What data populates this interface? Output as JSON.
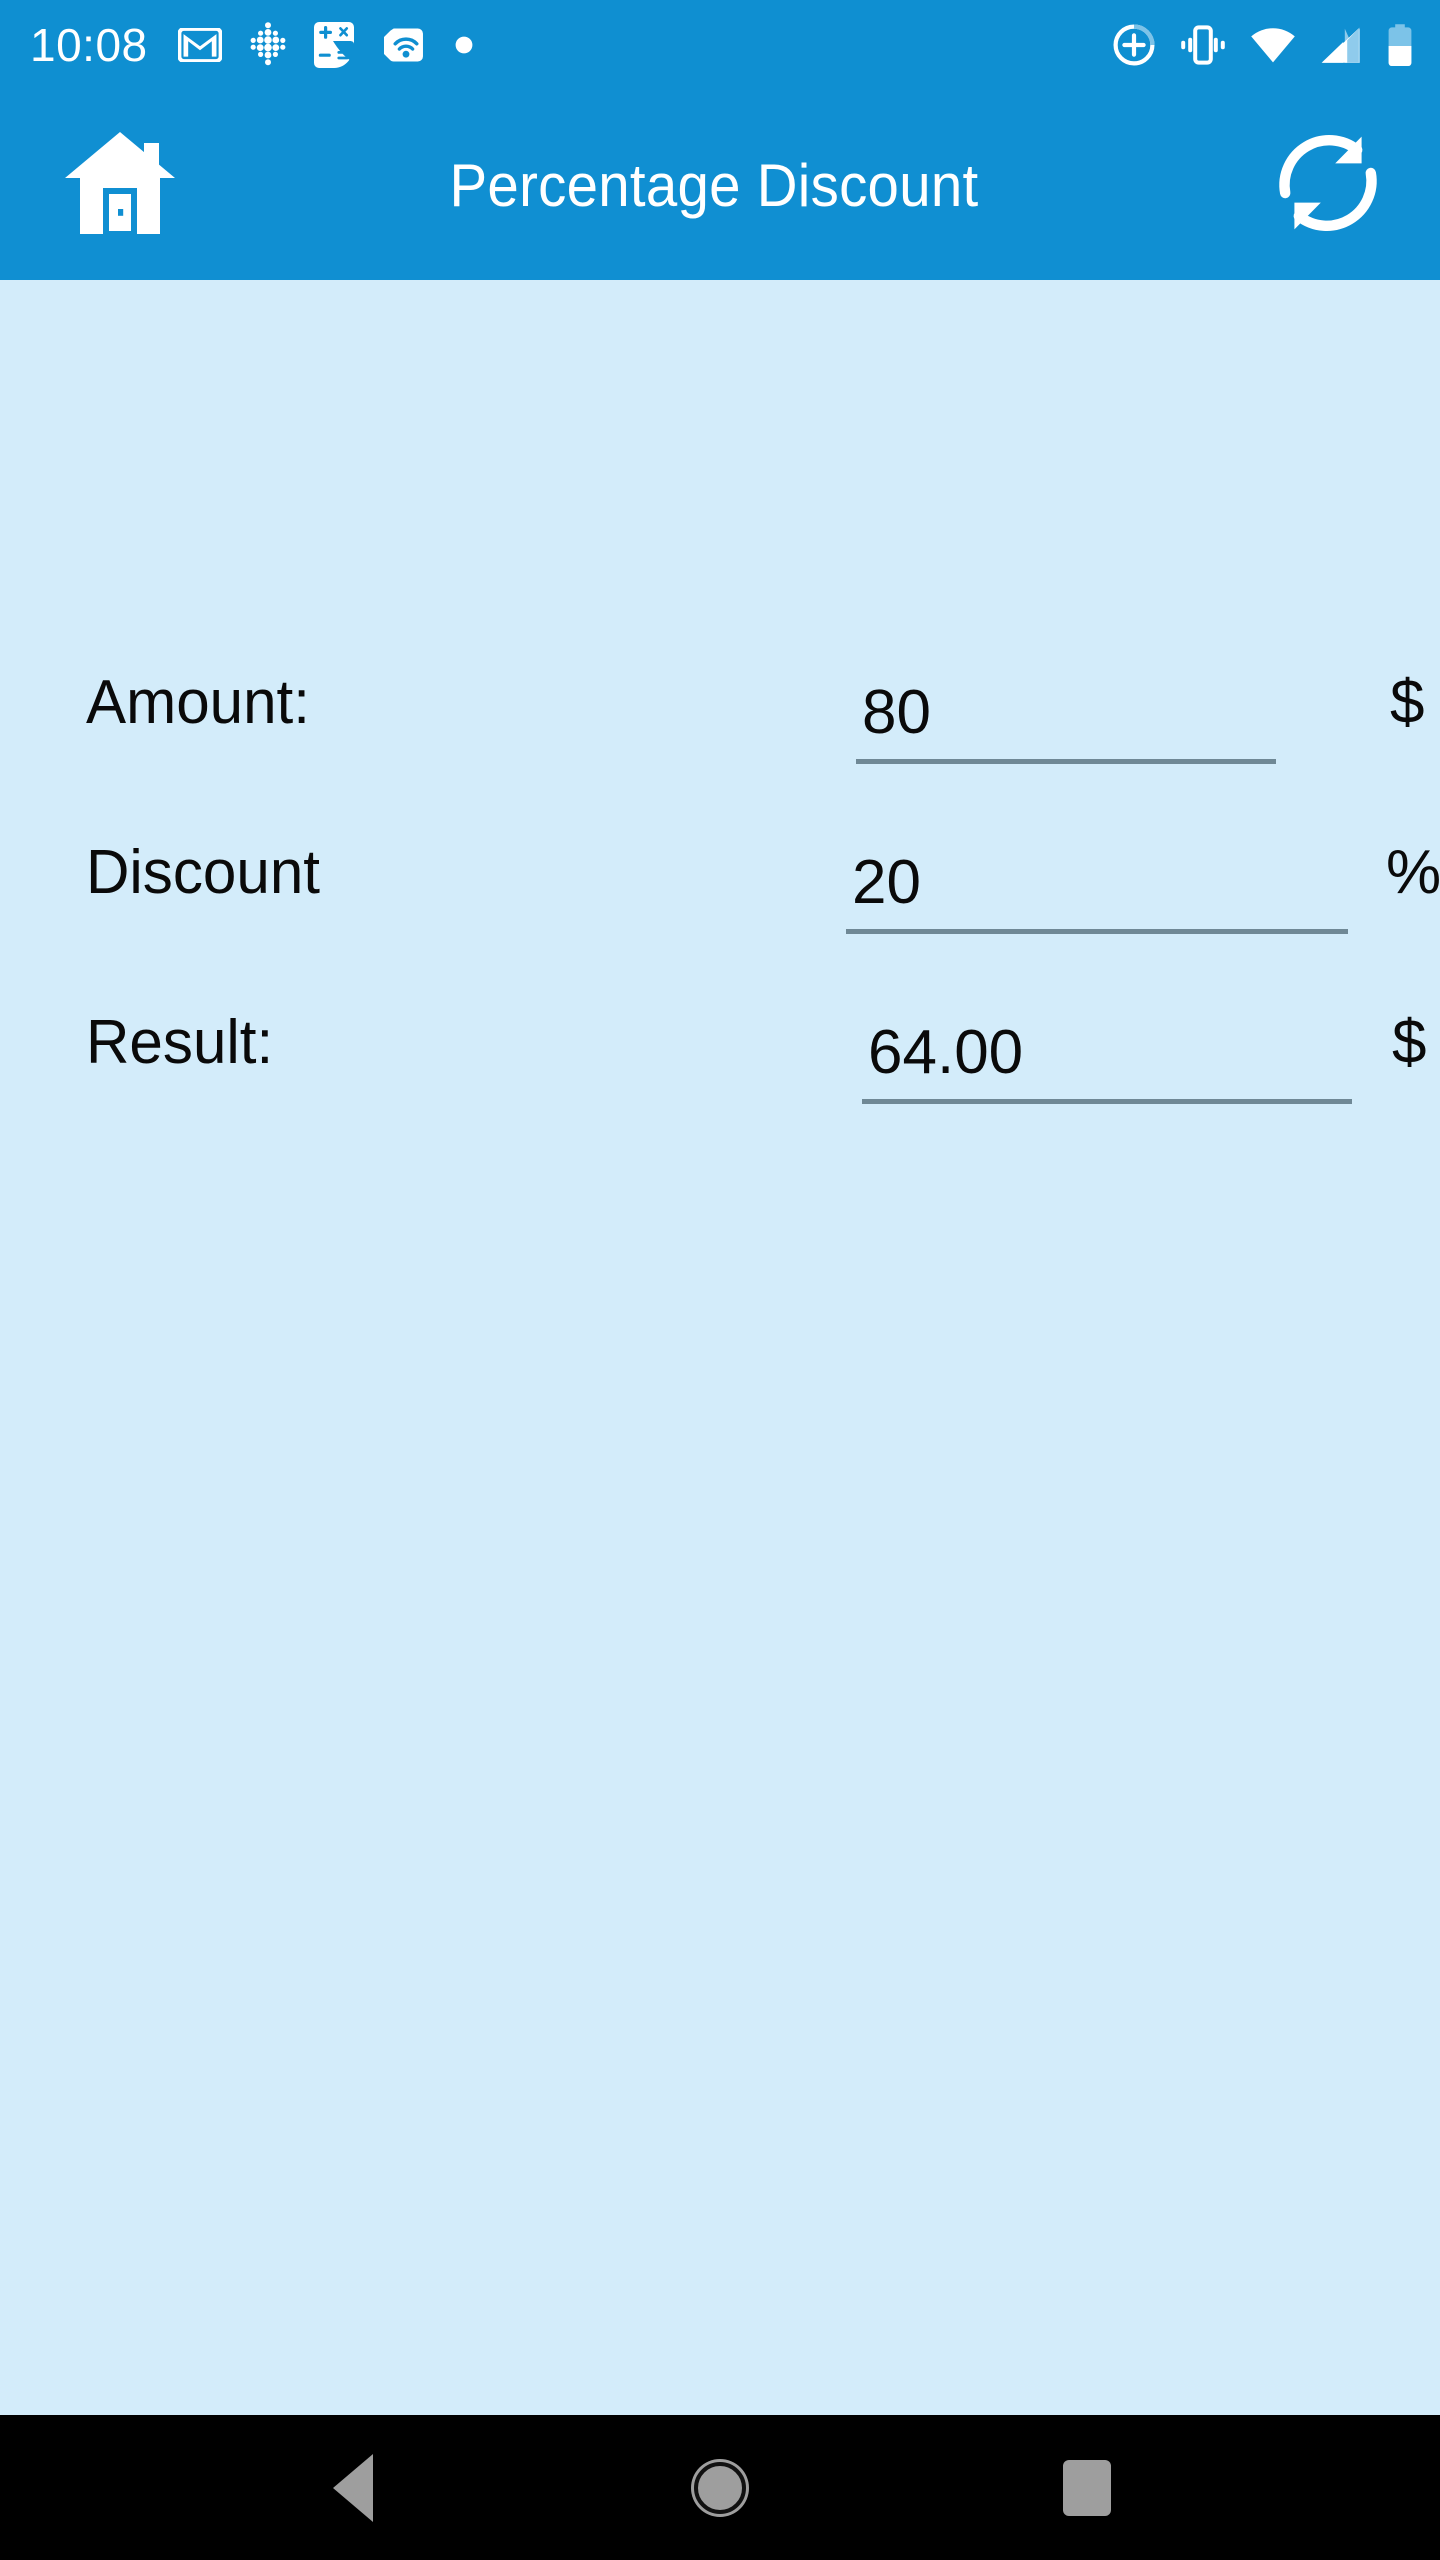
{
  "status_bar": {
    "time": "10:08",
    "left_icons": [
      {
        "name": "gmail-icon",
        "label": "Gmail"
      },
      {
        "name": "fitbit-dots-icon",
        "label": "Fitbit"
      },
      {
        "name": "calculator-icon",
        "label": "Calculator"
      },
      {
        "name": "nfc-tag-icon",
        "label": "NFC Tag"
      },
      {
        "name": "notification-dot-icon",
        "label": "More notifications"
      }
    ],
    "right_icons": [
      {
        "name": "add-circle-icon",
        "label": "Add"
      },
      {
        "name": "vibrate-icon",
        "label": "Vibrate mode"
      },
      {
        "name": "wifi-icon",
        "label": "Wi-Fi"
      },
      {
        "name": "cellular-signal-icon",
        "label": "Cellular signal"
      },
      {
        "name": "battery-icon",
        "label": "Battery"
      }
    ]
  },
  "app_bar": {
    "title": "Percentage Discount",
    "home_icon": "home-icon",
    "refresh_icon": "refresh-icon"
  },
  "form": {
    "rows": [
      {
        "label": "Amount:",
        "value": "80",
        "placeholder": "",
        "unit": "$",
        "readonly": false
      },
      {
        "label": "Discount",
        "value": "20",
        "placeholder": "",
        "unit": "%",
        "readonly": false
      },
      {
        "label": "Result:",
        "value": "64.00",
        "placeholder": "",
        "unit": "$",
        "readonly": true
      }
    ]
  },
  "nav_bar": {
    "back_label": "Back",
    "home_label": "Home",
    "recents_label": "Recent apps"
  },
  "colors": {
    "status_bar_blue": "#0F8FD1",
    "app_bar_blue": "#108FD2",
    "content_background": "#D3ECFA",
    "underline_gray": "#6F8895",
    "text_black": "#0A0A0A",
    "nav_bar_black": "#000000",
    "nav_icon_gray": "#9E9E9E"
  }
}
